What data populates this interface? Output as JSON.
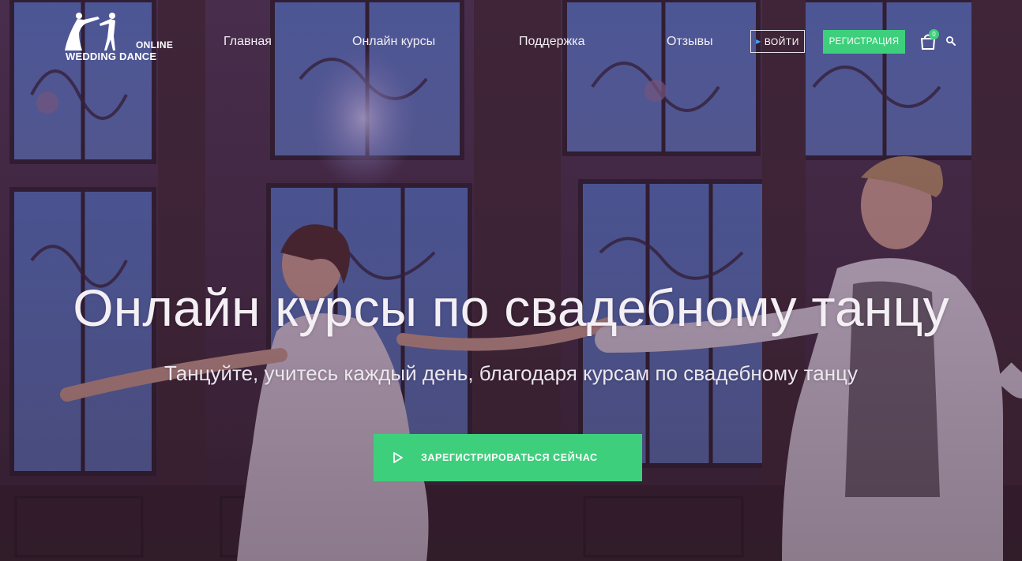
{
  "logo": {
    "line1": "ONLINE",
    "line2": "WEDDING DANCE"
  },
  "nav": {
    "items": [
      {
        "label": "Главная"
      },
      {
        "label": "Онлайн курсы"
      },
      {
        "label": "Поддержка"
      },
      {
        "label": "Отзывы"
      }
    ],
    "login_label": "ВОЙТИ",
    "register_label": "РЕГИСТРАЦИЯ",
    "cart_count": "0"
  },
  "hero": {
    "title": "Онлайн курсы по свадебному танцу",
    "subtitle": "Танцуйте, учитесь каждый день, благодаря курсам по свадебному танцу",
    "cta_label": "ЗАРЕГИСТРИРОВАТЬСЯ СЕЙЧАС"
  },
  "icons": {
    "login": "play-triangle-icon",
    "cart": "shopping-bag-icon",
    "search": "search-icon",
    "cta": "play-outline-icon"
  },
  "colors": {
    "accent": "#3ecf7c",
    "overlay": "#4a2a4e",
    "login_marker": "#3aa7ff"
  }
}
